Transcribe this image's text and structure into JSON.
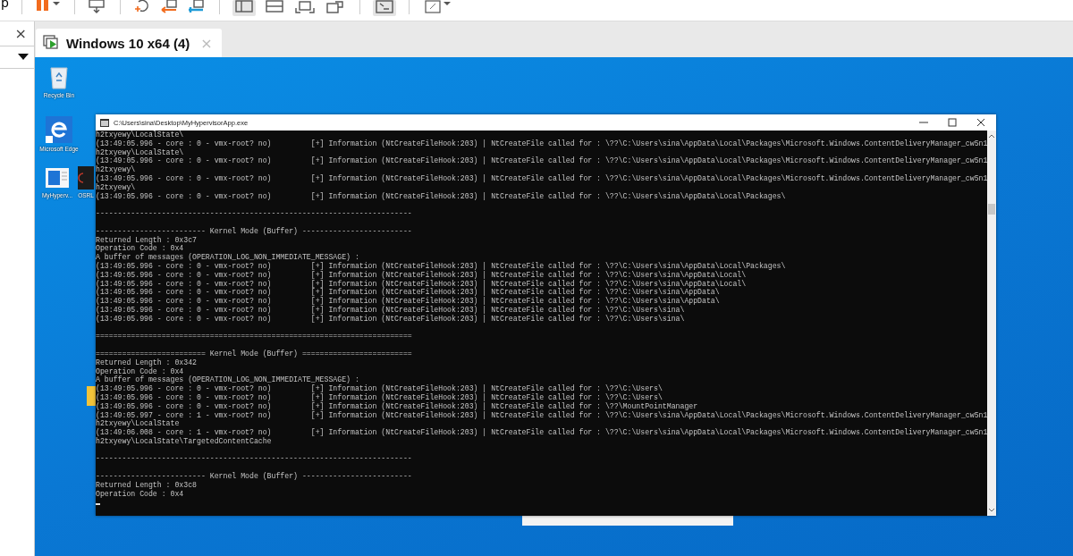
{
  "toolbar": {
    "menu_text": "p"
  },
  "library_panel": {
    "close": "×"
  },
  "tabs": [
    {
      "label": "Windows 10 x64 (4)",
      "selected": true,
      "close": "×"
    }
  ],
  "desktop_icons": [
    {
      "label": "Recycle Bin",
      "kind": "recycle"
    },
    {
      "label": "Microsoft Edge",
      "kind": "edge"
    },
    {
      "label": "MyHyperv...",
      "kind": "app"
    },
    {
      "label": "OSRL",
      "kind": "dark"
    }
  ],
  "console": {
    "title": "C:\\Users\\sina\\Desktop\\MyHypervisorApp.exe",
    "blocks": [
      {
        "lines": [
          "h2txyewy\\LocalState\\",
          "(13:49:05.996 - core : 0 - vmx-root? no)         [+] Information (NtCreateFileHook:203) | NtCreateFile called for : \\??\\C:\\Users\\sina\\AppData\\Local\\Packages\\Microsoft.Windows.ContentDeliveryManager_cw5n1",
          "h2txyewy\\LocalState\\",
          "(13:49:05.996 - core : 0 - vmx-root? no)         [+] Information (NtCreateFileHook:203) | NtCreateFile called for : \\??\\C:\\Users\\sina\\AppData\\Local\\Packages\\Microsoft.Windows.ContentDeliveryManager_cw5n1",
          "h2txyewy\\",
          "(13:49:05.996 - core : 0 - vmx-root? no)         [+] Information (NtCreateFileHook:203) | NtCreateFile called for : \\??\\C:\\Users\\sina\\AppData\\Local\\Packages\\Microsoft.Windows.ContentDeliveryManager_cw5n1",
          "h2txyewy\\",
          "(13:49:05.996 - core : 0 - vmx-root? no)         [+] Information (NtCreateFileHook:203) | NtCreateFile called for : \\??\\C:\\Users\\sina\\AppData\\Local\\Packages\\"
        ]
      },
      {
        "lines": [
          "------------------------------------------------------------------------"
        ]
      },
      {
        "lines": [
          "------------------------- Kernel Mode (Buffer) -------------------------",
          "Returned Length : 0x3c7",
          "Operation Code : 0x4",
          "A buffer of messages (OPERATION_LOG_NON_IMMEDIATE_MESSAGE) :",
          "(13:49:05.996 - core : 0 - vmx-root? no)         [+] Information (NtCreateFileHook:203) | NtCreateFile called for : \\??\\C:\\Users\\sina\\AppData\\Local\\Packages\\",
          "(13:49:05.996 - core : 0 - vmx-root? no)         [+] Information (NtCreateFileHook:203) | NtCreateFile called for : \\??\\C:\\Users\\sina\\AppData\\Local\\",
          "(13:49:05.996 - core : 0 - vmx-root? no)         [+] Information (NtCreateFileHook:203) | NtCreateFile called for : \\??\\C:\\Users\\sina\\AppData\\Local\\",
          "(13:49:05.996 - core : 0 - vmx-root? no)         [+] Information (NtCreateFileHook:203) | NtCreateFile called for : \\??\\C:\\Users\\sina\\AppData\\",
          "(13:49:05.996 - core : 0 - vmx-root? no)         [+] Information (NtCreateFileHook:203) | NtCreateFile called for : \\??\\C:\\Users\\sina\\AppData\\",
          "(13:49:05.996 - core : 0 - vmx-root? no)         [+] Information (NtCreateFileHook:203) | NtCreateFile called for : \\??\\C:\\Users\\sina\\",
          "(13:49:05.996 - core : 0 - vmx-root? no)         [+] Information (NtCreateFileHook:203) | NtCreateFile called for : \\??\\C:\\Users\\sina\\"
        ]
      },
      {
        "lines": [
          "========================================================================"
        ]
      },
      {
        "lines": [
          "========================= Kernel Mode (Buffer) =========================",
          "Returned Length : 0x342",
          "Operation Code : 0x4",
          "A buffer of messages (OPERATION_LOG_NON_IMMEDIATE_MESSAGE) :",
          "(13:49:05.996 - core : 0 - vmx-root? no)         [+] Information (NtCreateFileHook:203) | NtCreateFile called for : \\??\\C:\\Users\\",
          "(13:49:05.996 - core : 0 - vmx-root? no)         [+] Information (NtCreateFileHook:203) | NtCreateFile called for : \\??\\C:\\Users\\",
          "(13:49:05.996 - core : 0 - vmx-root? no)         [+] Information (NtCreateFileHook:203) | NtCreateFile called for : \\??\\MountPointManager",
          "(13:49:05.997 - core : 1 - vmx-root? no)         [+] Information (NtCreateFileHook:203) | NtCreateFile called for : \\??\\C:\\Users\\sina\\AppData\\Local\\Packages\\Microsoft.Windows.ContentDeliveryManager_cw5n1",
          "h2txyewy\\LocalState",
          "(13:49:06.008 - core : 1 - vmx-root? no)         [+] Information (NtCreateFileHook:203) | NtCreateFile called for : \\??\\C:\\Users\\sina\\AppData\\Local\\Packages\\Microsoft.Windows.ContentDeliveryManager_cw5n1",
          "h2txyewy\\LocalState\\TargetedContentCache"
        ]
      },
      {
        "lines": [
          "------------------------------------------------------------------------"
        ]
      },
      {
        "lines": [
          "------------------------- Kernel Mode (Buffer) -------------------------",
          "Returned Length : 0x3c8",
          "Operation Code : 0x4"
        ]
      }
    ]
  }
}
